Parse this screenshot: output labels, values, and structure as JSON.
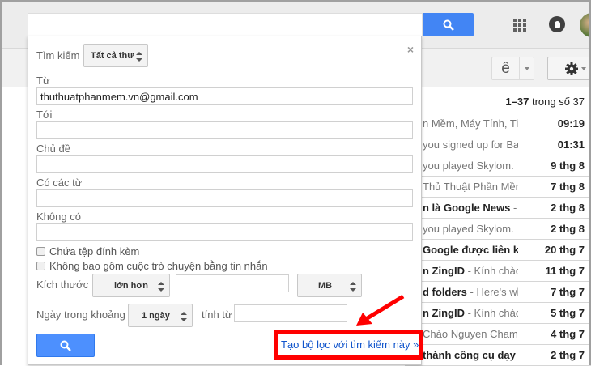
{
  "header": {
    "search_value": ""
  },
  "toolbar": {
    "lang_label": "ê",
    "count_range": "1–37",
    "count_text": "trong số 37"
  },
  "emails": [
    {
      "bold": "",
      "snippet": "n Mềm, Máy Tính, Ti",
      "date": "09:19"
    },
    {
      "bold": "",
      "snippet": "you signed up for Bay",
      "date": "01:31"
    },
    {
      "bold": "",
      "snippet": "you played Skylom.",
      "date": "9 thg 8"
    },
    {
      "bold": "",
      "snippet": "Thủ Thuật Phần Mền",
      "date": "7 thg 8"
    },
    {
      "bold": "n là Google News",
      "snippet": " - S",
      "date": "2 thg 8"
    },
    {
      "bold": "",
      "snippet": "you played Skylom.",
      "date": "2 thg 8"
    },
    {
      "bold": "Google được liên kế",
      "snippet": "",
      "date": "20 thg 7"
    },
    {
      "bold": "n ZingID",
      "snippet": " - Kính chào",
      "date": "11 thg 7"
    },
    {
      "bold": "d folders",
      "snippet": " - Here's wh",
      "date": "7 thg 7"
    },
    {
      "bold": "n ZingID",
      "snippet": " - Kính chào",
      "date": "5 thg 7"
    },
    {
      "bold": "",
      "snippet": "Chào Nguyen Cham,",
      "date": "4 thg 7"
    },
    {
      "bold": "thành công cụ dạy",
      "snippet": "",
      "date": "2 thg 7"
    }
  ],
  "search_panel": {
    "search_label": "Tìm kiếm",
    "scope": "Tất cả thư",
    "from_label": "Từ",
    "from_value": "thuthuatphanmem.vn@gmail.com",
    "to_label": "Tới",
    "to_value": "",
    "subject_label": "Chủ đề",
    "subject_value": "",
    "has_words_label": "Có các từ",
    "has_words_value": "",
    "not_has_label": "Không có",
    "not_has_value": "",
    "has_attachment": "Chứa tệp đính kèm",
    "exclude_chats": "Không bao gồm cuộc trò chuyện bằng tin nhắn",
    "size_label": "Kích thước",
    "size_op": "lớn hơn",
    "size_value": "",
    "size_unit": "MB",
    "date_label": "Ngày trong khoảng",
    "date_range": "1 ngày",
    "date_from_label": "tính từ",
    "date_from_value": "",
    "create_filter": "Tạo bộ lọc với tìm kiếm này »",
    "close": "×"
  },
  "colors": {
    "accent": "#4285f4",
    "highlight": "#ff0000",
    "link": "#1155cc"
  }
}
